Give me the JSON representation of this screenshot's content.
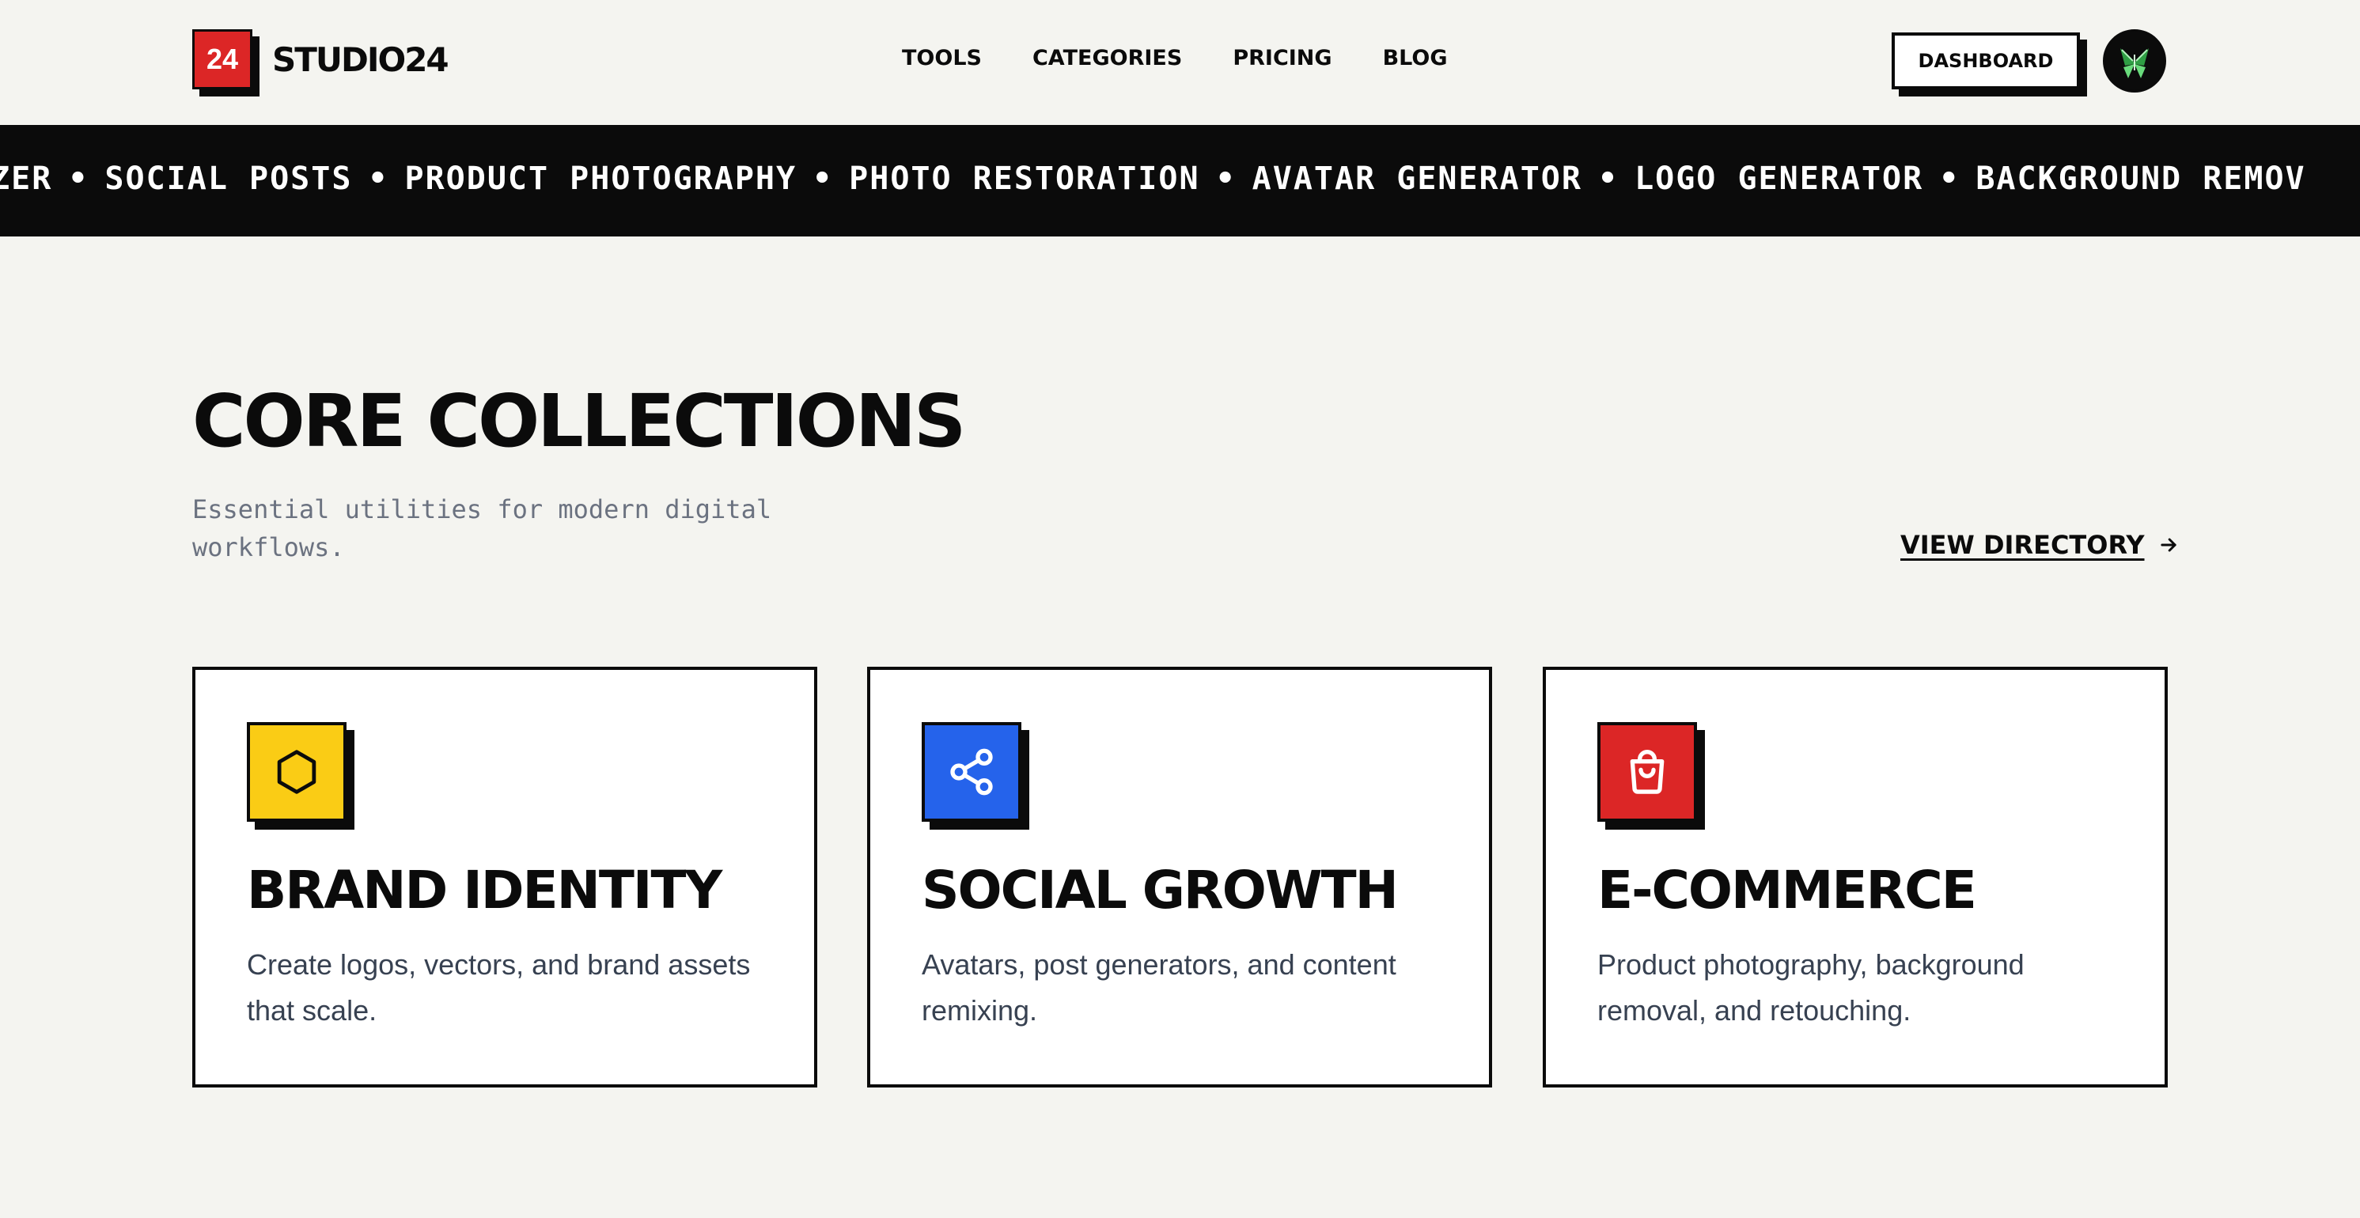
{
  "header": {
    "logo_badge": "24",
    "logo_text": "STUDIO24",
    "nav": [
      "TOOLS",
      "CATEGORIES",
      "PRICING",
      "BLOG"
    ],
    "dashboard_label": "DASHBOARD"
  },
  "marquee": {
    "items": [
      "IZER",
      "SOCIAL POSTS",
      "PRODUCT PHOTOGRAPHY",
      "PHOTO RESTORATION",
      "AVATAR GENERATOR",
      "LOGO GENERATOR",
      "BACKGROUND REMOV"
    ],
    "separator": "•"
  },
  "section": {
    "title": "CORE COLLECTIONS",
    "subtitle": "Essential utilities for modern digital workflows.",
    "view_directory_label": "VIEW DIRECTORY"
  },
  "cards": [
    {
      "title": "BRAND IDENTITY",
      "description": "Create logos, vectors, and brand assets that scale.",
      "icon": "hexagon-icon",
      "color": "#facc15"
    },
    {
      "title": "SOCIAL GROWTH",
      "description": "Avatars, post generators, and content remixing.",
      "icon": "share-icon",
      "color": "#2563eb"
    },
    {
      "title": "E-COMMERCE",
      "description": "Product photography, background removal, and retouching.",
      "icon": "shopping-bag-icon",
      "color": "#dc2626"
    }
  ],
  "colors": {
    "background": "#f4f4f0",
    "ink": "#0b0b0b",
    "brand_red": "#dc2626",
    "muted_text": "#6b7280"
  }
}
